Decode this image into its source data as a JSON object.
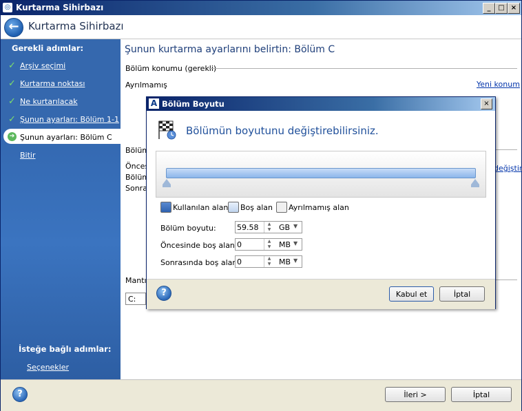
{
  "window": {
    "title": "Kurtarma Sihirbazı",
    "icon": "acronis-app-icon"
  },
  "header": {
    "title": "Kurtarma Sihirbazı"
  },
  "sidebar": {
    "required_heading": "Gerekli adımlar:",
    "items": [
      {
        "label": "Arşiv seçimi",
        "state": "done"
      },
      {
        "label": "Kurtarma noktası",
        "state": "done"
      },
      {
        "label": "Ne kurtarılacak",
        "state": "done"
      },
      {
        "label": "Şunun ayarları: Bölüm 1-1",
        "state": "done"
      },
      {
        "label": "Şunun ayarları: Bölüm C",
        "state": "current"
      },
      {
        "label": "Bitir",
        "state": "pending"
      }
    ],
    "optional_heading": "İsteğe bağlı adımlar:",
    "options_link": "Seçenekler"
  },
  "main": {
    "title": "Şunun kurtarma ayarlarını belirtin: Bölüm C",
    "location_section": "Bölüm konumu (gerekli)",
    "location_value": "Ayrılmamış",
    "new_location_link": "Yeni konum",
    "props_section_partial": "Bölüm",
    "before_partial": "Öncesi",
    "size_partial": "Bölüm",
    "after_partial": "Sonra",
    "change_link_partial": "değiştir",
    "logical_partial": "Mantık",
    "drive_letter": "C:"
  },
  "dialog": {
    "title": "Bölüm Boyutu",
    "headline": "Bölümün boyutunu değiştirebilirsiniz.",
    "legend": {
      "used": "Kullanılan alan",
      "free": "Boş alan",
      "unallocated": "Ayrılmamış alan"
    },
    "fields": {
      "size_label": "Bölüm boyutu:",
      "size_value": "59.58",
      "size_unit": "GB",
      "before_label": "Öncesinde boş alan:",
      "before_value": "0",
      "before_unit": "MB",
      "after_label": "Sonrasında boş alan:",
      "after_value": "0",
      "after_unit": "MB"
    },
    "ok_button": "Kabul et",
    "cancel_button": "İptal"
  },
  "footer": {
    "next_button": "İleri >",
    "cancel_button": "İptal"
  },
  "colors": {
    "accent": "#2d5ea3",
    "title_bar": "#0a246a",
    "link": "#0033aa"
  }
}
